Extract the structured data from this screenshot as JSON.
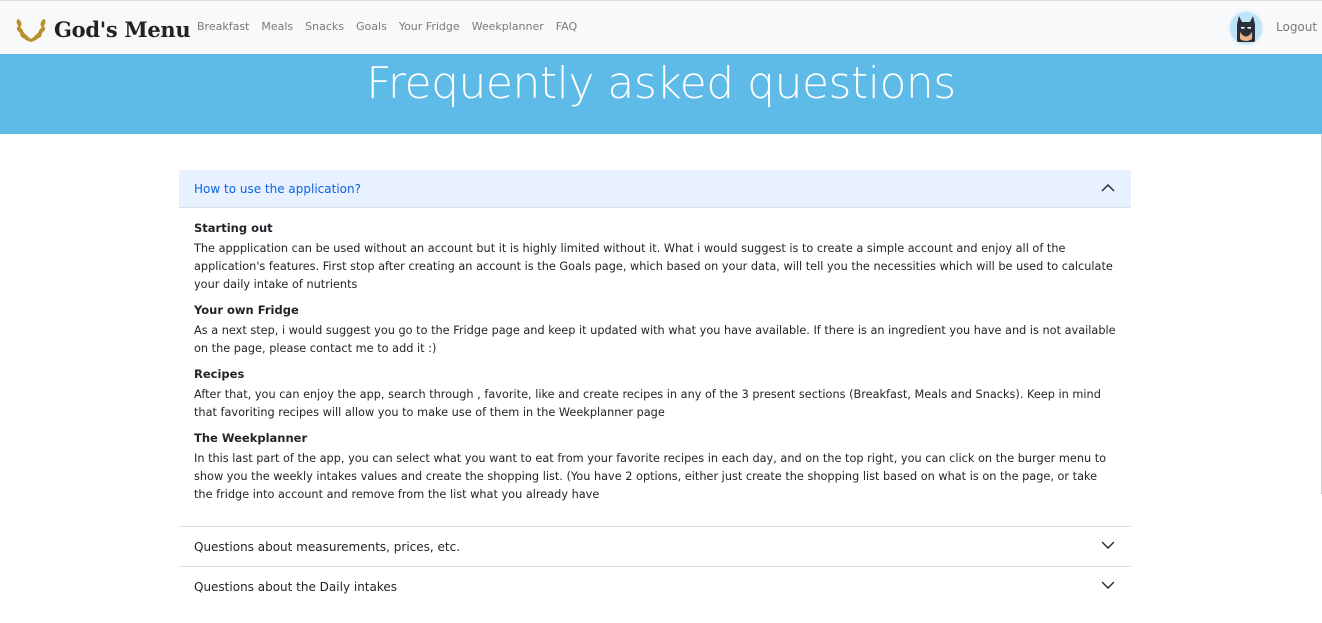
{
  "brand": {
    "name": "God's Menu",
    "logo": "laurel-wreath-icon"
  },
  "nav": {
    "links": [
      "Breakfast",
      "Meals",
      "Snacks",
      "Goals",
      "Your Fridge",
      "Weekplanner",
      "FAQ"
    ],
    "avatar": "batman-avatar",
    "logout": "Logout"
  },
  "hero": {
    "title": "Frequently asked questions"
  },
  "accordion": {
    "items": [
      {
        "title": "How to use the application?",
        "expanded": true,
        "sections": [
          {
            "heading": "Starting out",
            "text": "The appplication can be used without an account but it is highly limited without it. What i would suggest is to create a simple account and enjoy all of the application's features. First stop after creating an account is the Goals page, which based on your data, will tell you the necessities which will be used to calculate your daily intake of nutrients"
          },
          {
            "heading": "Your own Fridge",
            "text": "As a next step, i would suggest you go to the Fridge page and keep it updated with what you have available. If there is an ingredient you have and is not available on the page, please contact me to add it :)"
          },
          {
            "heading": "Recipes",
            "text": "After that, you can enjoy the app, search through , favorite, like and create recipes in any of the 3 present sections (Breakfast, Meals and Snacks). Keep in mind that favoriting recipes will allow you to make use of them in the Weekplanner page"
          },
          {
            "heading": "The Weekplanner",
            "text": "In this last part of the app, you can select what you want to eat from your favorite recipes in each day, and on the top right, you can click on the burger menu to show you the weekly intakes values and create the shopping list. (You have 2 options, either just create the shopping list based on what is on the page, or take the fridge into account and remove from the list what you already have"
          }
        ]
      },
      {
        "title": "Questions about measurements, prices, etc.",
        "expanded": false
      },
      {
        "title": "Questions about the Daily intakes",
        "expanded": false
      }
    ]
  },
  "colors": {
    "hero": "#5ebae6",
    "open_header_bg": "#e7f1ff",
    "open_header_text": "#0c63e4"
  },
  "icons": {
    "open": "chevron-up-icon",
    "closed": "chevron-down-icon"
  }
}
